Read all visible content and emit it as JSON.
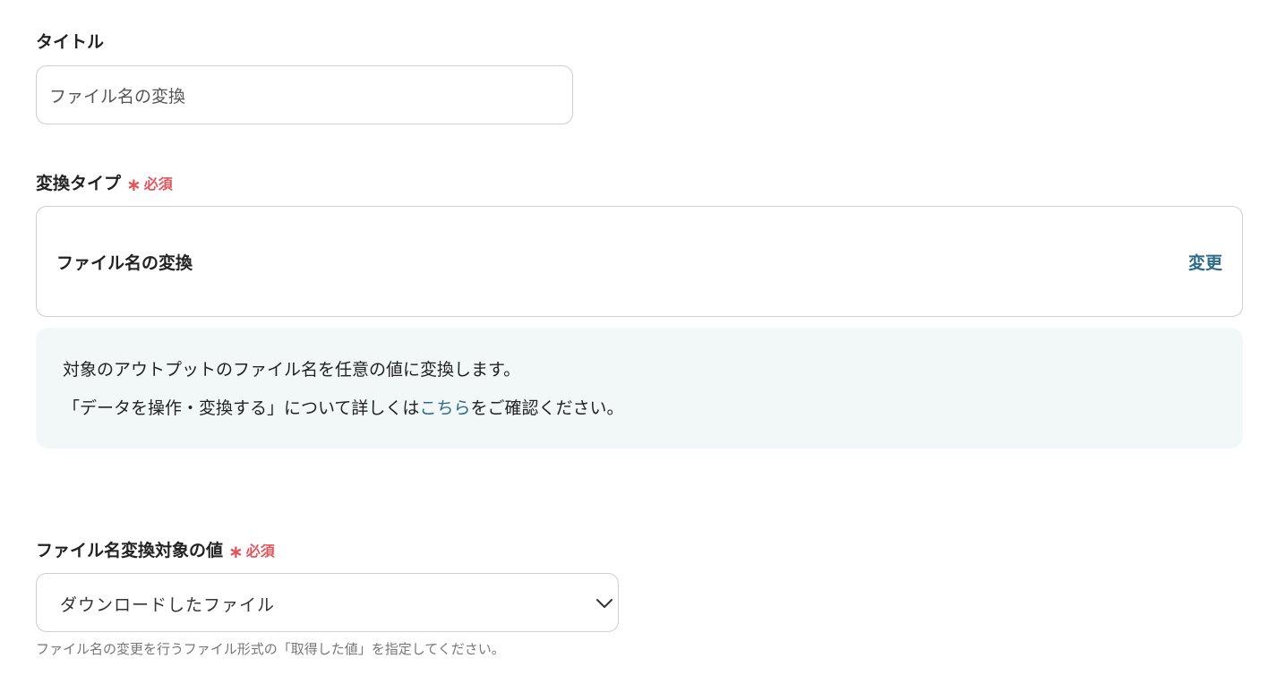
{
  "title_field": {
    "label": "タイトル",
    "value": "ファイル名の変換"
  },
  "conversion_type": {
    "label": "変換タイプ",
    "required_star": "∗",
    "required_text": "必須",
    "value": "ファイル名の変換",
    "change_label": "変更"
  },
  "info": {
    "line1": "対象のアウトプットのファイル名を任意の値に変換します。",
    "line2_before": "「データを操作・変換する」について詳しくは",
    "line2_link": "こちら",
    "line2_after": "をご確認ください。"
  },
  "target_value": {
    "label": "ファイル名変換対象の値",
    "required_star": "∗",
    "required_text": "必須",
    "selected": "ダウンロードしたファイル",
    "help": "ファイル名の変更を行うファイル形式の「取得した値」を指定してください。"
  },
  "colors": {
    "required": "#e2555c",
    "link": "#2e6b8a",
    "info_background": "#f2f8f8",
    "border": "#cfcfcf"
  },
  "icons": {
    "select_chevron": "chevron-down-icon"
  }
}
